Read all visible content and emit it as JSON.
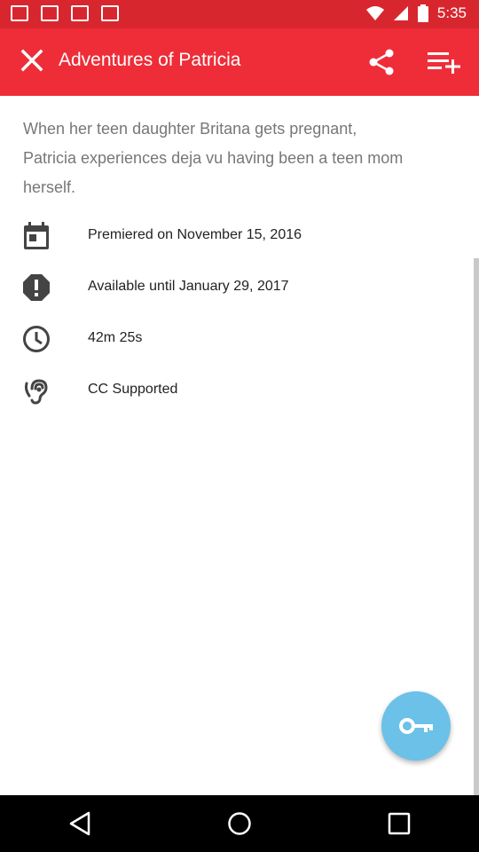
{
  "status_bar": {
    "time": "5:35",
    "icons": [
      "notification-icon",
      "notification-icon",
      "notification-icon",
      "notification-icon",
      "wifi-icon",
      "signal-icon",
      "battery-icon"
    ]
  },
  "app_bar": {
    "title": "Adventures of Patricia",
    "close_icon": "close-icon",
    "share_icon": "share-icon",
    "playlist_add_icon": "playlist-add-icon",
    "background_color": "#ee2d38"
  },
  "description": "When her teen daughter Britana gets pregnant, Patricia experiences deja vu having been a teen mom herself.",
  "info_rows": [
    {
      "icon": "calendar-icon",
      "text": "Premiered on November 15, 2016"
    },
    {
      "icon": "alert-icon",
      "text": "Available until January 29, 2017"
    },
    {
      "icon": "clock-icon",
      "text": "42m 25s"
    },
    {
      "icon": "hearing-icon",
      "text": "CC Supported"
    }
  ],
  "fab": {
    "icon": "key-icon",
    "color": "#6bc1e8"
  },
  "nav_bar": {
    "icons": [
      "back-icon",
      "home-icon",
      "recents-icon"
    ]
  }
}
